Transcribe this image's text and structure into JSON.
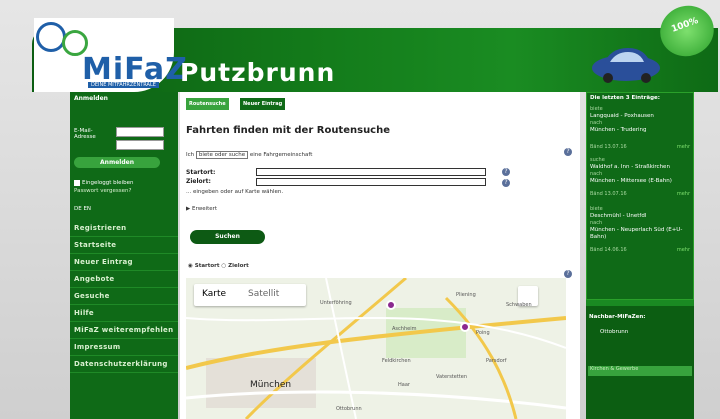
{
  "header": {
    "logo": "MiFaZ",
    "logo_sub": "DEINE MITFAHRZENTRALE",
    "city": "Putzbrunn",
    "badge": "100%"
  },
  "sidebar": {
    "login_heading": "Anmelden",
    "email_label": "E-Mail-Adresse",
    "login_button": "Anmelden",
    "remember_label": "Eingeloggt bleiben",
    "forgot_link": "Passwort vergessen?",
    "flags": "DE EN",
    "links": [
      "Registrieren",
      "Startseite",
      "Neuer Eintrag",
      "Angebote",
      "Gesuche",
      "Hilfe",
      "MiFaZ weiterempfehlen",
      "Impressum",
      "Datenschutzerklärung"
    ]
  },
  "main": {
    "tabs": [
      "Routensuche",
      "Neuer Eintrag"
    ],
    "title": "Fahrten finden mit der Routensuche",
    "intro_prefix": "Ich",
    "intro_select": "biete oder suche",
    "intro_suffix": "eine Fahrgemeinschaft",
    "start_label": "Startort:",
    "dest_label": "Zielort:",
    "hint": "... eingeben oder auf Karte wählen.",
    "advanced": "▶ Erweitert",
    "search_button": "Suchen",
    "radio_start": "Startort",
    "radio_dest": "Zielort"
  },
  "map": {
    "tab_map": "Karte",
    "tab_satellite": "Satellit",
    "city_label": "München",
    "labels": [
      "Unterföhring",
      "Aschheim",
      "Feldkirchen",
      "Haar",
      "Ottobrunn",
      "Pliening",
      "Poing",
      "Schwaben",
      "Parsdorf",
      "Vaterstetten"
    ]
  },
  "right": {
    "latest_heading": "Die letzten 3 Einträge:",
    "entries": [
      {
        "type": "biete",
        "route": "Langquaid - Poxhausen",
        "when": "nach",
        "dest": "München - Trudering",
        "date": "Bänd 13.07.16",
        "more": "mehr"
      },
      {
        "type": "suche",
        "route": "Waldhof a. Inn - Straßkirchen",
        "when": "nach",
        "dest": "München - Mittersee (E-Bahn)",
        "date": "Bänd 13.07.16",
        "more": "mehr"
      },
      {
        "type": "biete",
        "route": "Deschmühl - Unetfdl",
        "when": "nach",
        "dest": "München - Neuperlach Süd (E+U-Bahn)",
        "date": "Bänd 14.06.16",
        "more": "mehr"
      }
    ],
    "coverage_heading": "Nachbar-MiFaZen:",
    "coverage_item": "Ottobrunn",
    "coverage_field": "Kirchen & Gewerbe"
  },
  "colors": {
    "green_dark": "#0f6a17",
    "green_bright": "#38a33d",
    "pin": "#8b2a8f"
  }
}
